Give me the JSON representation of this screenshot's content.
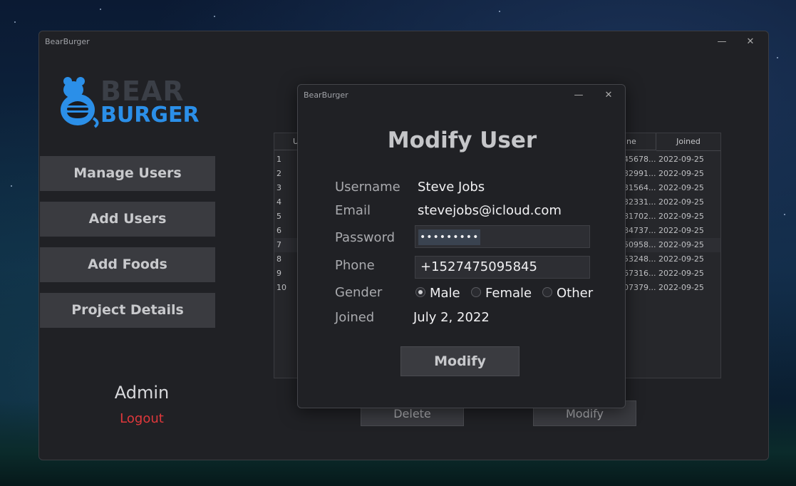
{
  "app": {
    "title": "BearBurger"
  },
  "logo": {
    "line1": "BEAR",
    "line2": "BURGER"
  },
  "nav": {
    "items": [
      "Manage Users",
      "Add Users",
      "Add Foods",
      "Project Details"
    ]
  },
  "user_panel": {
    "role": "Admin",
    "logout": "Logout"
  },
  "table": {
    "headers": [
      "U",
      "ne",
      "Joined"
    ],
    "rows": [
      {
        "id": "1",
        "phone": "45678...",
        "joined": "2022-09-25"
      },
      {
        "id": "2",
        "phone": "32991...",
        "joined": "2022-09-25"
      },
      {
        "id": "3",
        "phone": "31564...",
        "joined": "2022-09-25"
      },
      {
        "id": "4",
        "phone": "32331...",
        "joined": "2022-09-25"
      },
      {
        "id": "5",
        "phone": "81702...",
        "joined": "2022-09-25"
      },
      {
        "id": "6",
        "phone": "84737...",
        "joined": "2022-09-25"
      },
      {
        "id": "7",
        "phone": "50958...",
        "joined": "2022-09-25"
      },
      {
        "id": "8",
        "phone": "53248...",
        "joined": "2022-09-25"
      },
      {
        "id": "9",
        "phone": "67316...",
        "joined": "2022-09-25"
      },
      {
        "id": "10",
        "phone": "07379...",
        "joined": "2022-09-25"
      }
    ]
  },
  "actions": {
    "delete": "Delete",
    "modify": "Modify"
  },
  "dialog": {
    "window_title": "BearBurger",
    "title": "Modify User",
    "labels": {
      "username": "Username",
      "email": "Email",
      "password": "Password",
      "phone": "Phone",
      "gender": "Gender",
      "joined": "Joined"
    },
    "values": {
      "username": "Steve Jobs",
      "email": "stevejobs@icloud.com",
      "password": "•••••••••",
      "phone": "+1527475095845",
      "joined": "July 2, 2022"
    },
    "gender_options": [
      "Male",
      "Female",
      "Other"
    ],
    "gender_selected": "Male",
    "submit": "Modify"
  },
  "window_controls": {
    "minimize": "—",
    "close": "✕"
  },
  "colors": {
    "accent": "#2b8fe8",
    "logout": "#e0383b",
    "panel": "#202125"
  }
}
